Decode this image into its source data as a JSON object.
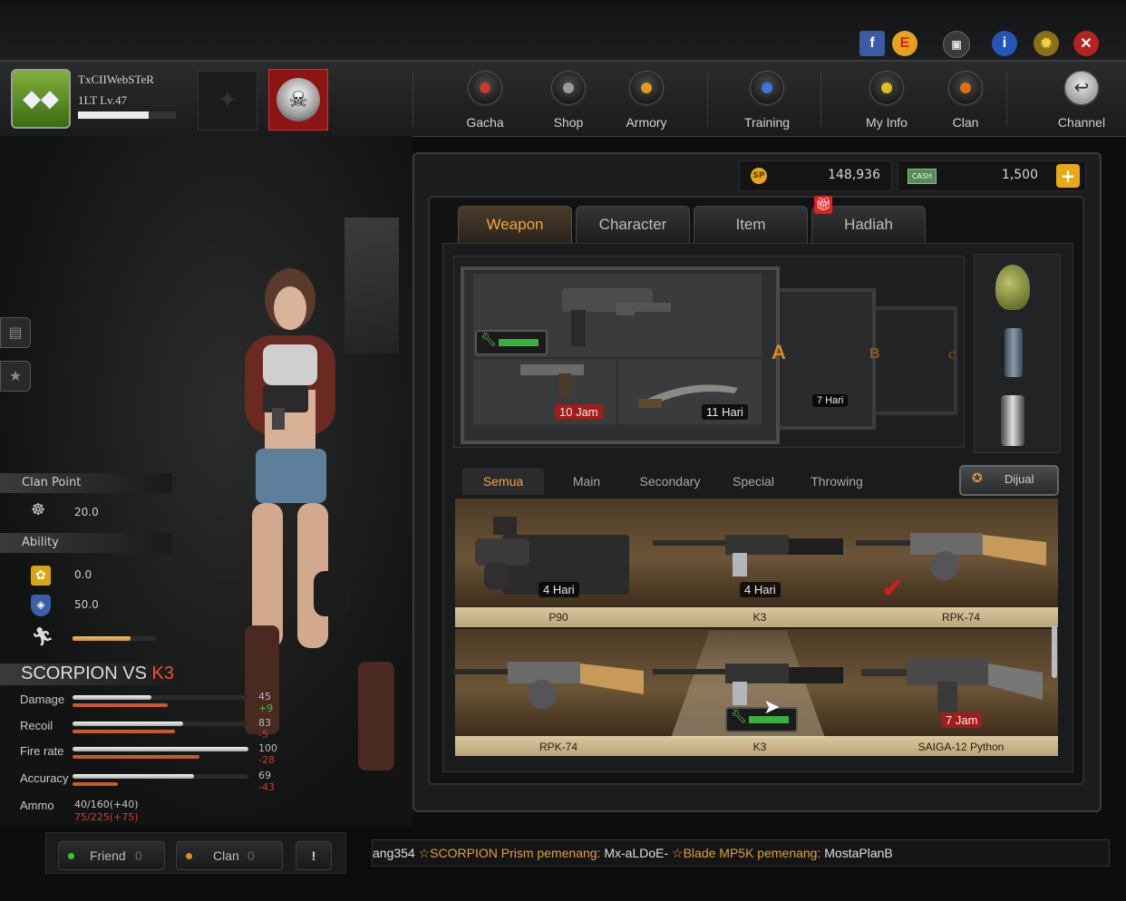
{
  "top_icons": [
    "facebook-icon",
    "e-event-icon",
    "screen-icon",
    "info-icon",
    "settings-icon",
    "close-icon"
  ],
  "player": {
    "name": "TxCIIWebSTeR",
    "rank": "1LT Lv.47",
    "exp_fraction": 0.72
  },
  "nav": [
    {
      "label": "Gacha",
      "dot": "#c83a2a"
    },
    {
      "label": "Shop",
      "dot": "#9a9a9a"
    },
    {
      "label": "Armory",
      "dot": "#e09a1c"
    },
    {
      "label": "Training",
      "dot": "#3a78d8"
    },
    {
      "label": "My Info",
      "dot": "#e0c010"
    },
    {
      "label": "Clan",
      "dot": "#e07010"
    },
    {
      "label": "Channel",
      "dot": ""
    }
  ],
  "clan_point": {
    "heading": "Clan Point",
    "value": "20.0"
  },
  "ability": {
    "heading": "Ability",
    "values": [
      "0.0",
      "50.0"
    ],
    "speed_fraction": 0.7
  },
  "compare": {
    "title_a": "SCORPION",
    "vs": "VS",
    "title_b": "K3",
    "rows": [
      {
        "label": "Damage",
        "value": "45",
        "delta": "+9",
        "a": 0.45,
        "b": 0.54
      },
      {
        "label": "Recoil",
        "value": "83",
        "delta": "-5",
        "a": 0.63,
        "b": 0.58
      },
      {
        "label": "Fire rate",
        "value": "100",
        "delta": "-28",
        "a": 1.0,
        "b": 0.72
      },
      {
        "label": "Accuracy",
        "value": "69",
        "delta": "-43",
        "a": 0.69,
        "b": 0.26
      }
    ],
    "ammo_label": "Ammo",
    "ammo_a": "40/160(+40)",
    "ammo_b": "75/225(+75)"
  },
  "currency": {
    "sp": "148,936",
    "cash": "1,500"
  },
  "tabs": [
    "Weapon",
    "Character",
    "Item",
    "Hadiah"
  ],
  "loadout": {
    "primary_time": "",
    "secondary_time": "10 Jam",
    "melee_time": "11 Hari",
    "b_time": "7 Hari",
    "letters": [
      "A",
      "B",
      "C"
    ]
  },
  "subtabs": [
    "Semua",
    "Main",
    "Secondary",
    "Special",
    "Throwing"
  ],
  "sell_label": "Dijual",
  "shelf1": [
    {
      "name": "P90",
      "time": "4 Hari"
    },
    {
      "name": "K3",
      "time": "4 Hari"
    },
    {
      "name": "RPK-74",
      "time": ""
    }
  ],
  "shelf2": [
    {
      "name": "RPK-74",
      "time": ""
    },
    {
      "name": "K3",
      "time": ""
    },
    {
      "name": "SAIGA-12 Python",
      "time": "7 Jam"
    }
  ],
  "bottom": {
    "friend": "Friend",
    "friend_count": "0",
    "clan": "Clan",
    "clan_count": "0",
    "alert": "!"
  },
  "ticker": {
    "p1": "ang354",
    "item1": "☆SCORPION Prism pemenang:",
    "winner1": "Mx-aLDoE-",
    "item2": "☆Blade MP5K pemenang:",
    "winner2": "MostaPlanB"
  }
}
